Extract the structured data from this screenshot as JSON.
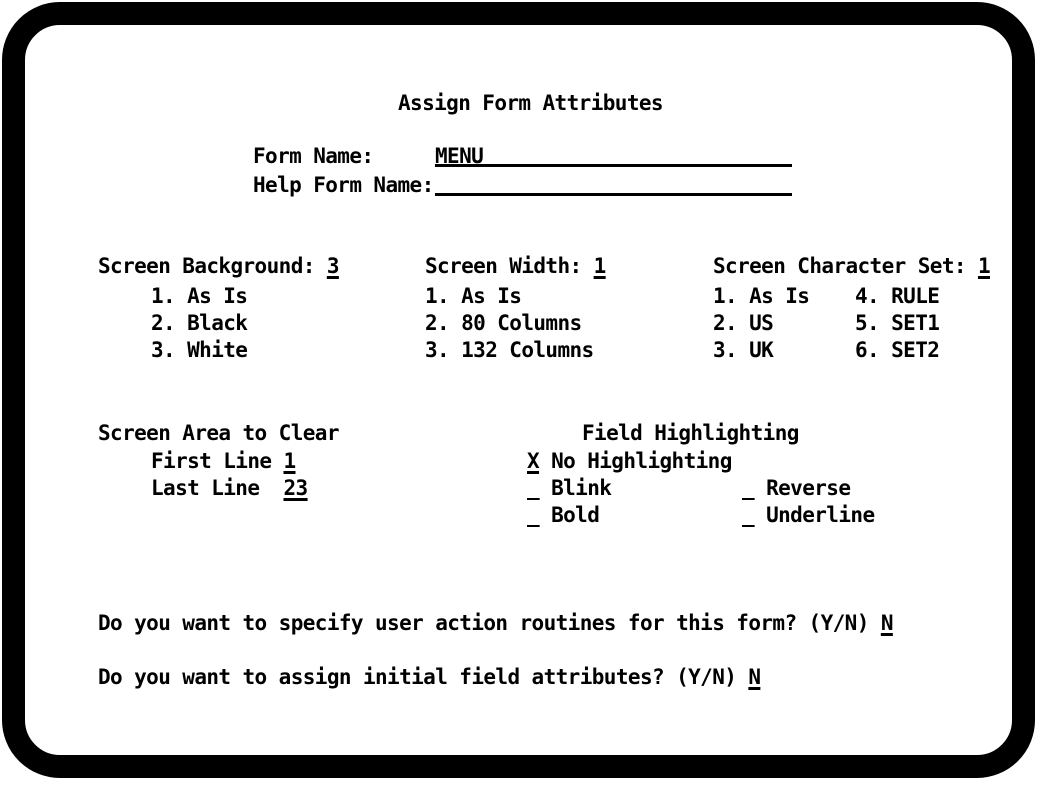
{
  "screen": {
    "title": "Assign Form Attributes"
  },
  "form": {
    "form_name_label": "Form Name:",
    "form_name_value": "MENU",
    "help_form_name_label": "Help Form Name:",
    "help_form_name_value": ""
  },
  "screen_background": {
    "label": "Screen Background:",
    "value": "3",
    "options": [
      "1. As Is",
      "2. Black",
      "3. White"
    ]
  },
  "screen_width": {
    "label": "Screen Width:",
    "value": "1",
    "options": [
      "1. As Is",
      "2. 80 Columns",
      "3. 132 Columns"
    ]
  },
  "screen_character_set": {
    "label": "Screen Character Set:",
    "value": "1",
    "options_left": [
      "1. As Is",
      "2. US",
      "3. UK"
    ],
    "options_right": [
      "4. RULE",
      "5. SET1",
      "6. SET2"
    ]
  },
  "screen_area_to_clear": {
    "heading": "Screen Area to Clear",
    "first_line_label": "First Line",
    "first_line_value": "1",
    "last_line_label": "Last Line",
    "last_line_value": "23"
  },
  "field_highlighting": {
    "heading": "Field Highlighting",
    "items": [
      {
        "mark": "X",
        "label": "No Highlighting",
        "selected": true
      },
      {
        "mark": "_",
        "label": "Blink",
        "selected": false
      },
      {
        "mark": "_",
        "label": "Bold",
        "selected": false
      },
      {
        "mark": "_",
        "label": "Reverse",
        "selected": false
      },
      {
        "mark": "_",
        "label": "Underline",
        "selected": false
      }
    ]
  },
  "prompts": {
    "user_action_routines": "Do you want to specify user action routines for this form? (Y/N)",
    "user_action_routines_value": "N",
    "initial_field_attributes": "Do you want to assign initial field attributes? (Y/N)",
    "initial_field_attributes_value": "N"
  },
  "colors": {
    "foreground": "#000000",
    "background": "#ffffff",
    "bezel": "#000000"
  }
}
